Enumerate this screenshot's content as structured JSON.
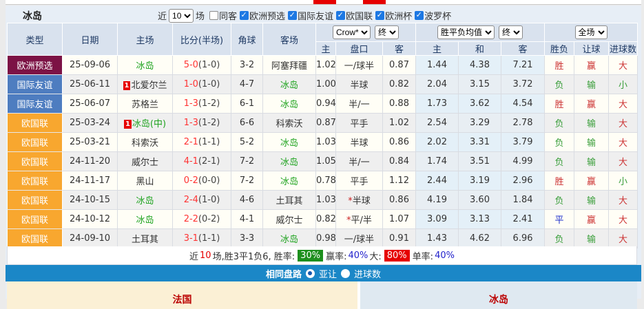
{
  "topbar": {
    "title": "冰岛",
    "near_label": "近",
    "games_value": "10",
    "games_label": "场",
    "checkboxes": [
      {
        "label": "同客",
        "checked": false
      },
      {
        "label": "欧洲预选",
        "checked": true
      },
      {
        "label": "国际友谊",
        "checked": true
      },
      {
        "label": "欧国联",
        "checked": true
      },
      {
        "label": "欧洲杯",
        "checked": true
      },
      {
        "label": "波罗杯",
        "checked": true
      }
    ]
  },
  "table": {
    "headers": {
      "type": "类型",
      "date": "日期",
      "home": "主场",
      "score": "比分(半场)",
      "corner": "角球",
      "away": "客场",
      "odds_source_select": "Crow*",
      "final_select_1": "终",
      "avg_select": "胜平负均值",
      "final_select_2": "终",
      "scope_select": "全场",
      "sub": [
        "主",
        "盘口",
        "客",
        "主",
        "和",
        "客",
        "胜负",
        "让球",
        "进球数"
      ]
    },
    "rows": [
      {
        "type": "欧洲预选",
        "type_color": "#7C1245",
        "date": "25-09-06",
        "badge": false,
        "home": "冰岛",
        "home_green": true,
        "score": "5-0",
        "half": "(1-0)",
        "corner": "3-2",
        "away": "阿塞拜疆",
        "away_green": false,
        "o1": "1.02",
        "star": false,
        "handicap": "一/球半",
        "o2": "0.87",
        "a1": "1.44",
        "a2": "4.38",
        "a3": "7.21",
        "r1": "胜",
        "r1c": "r",
        "r2": "赢",
        "r2c": "r",
        "r3": "大",
        "r3c": "r"
      },
      {
        "type": "国际友谊",
        "type_color": "#4E7DC0",
        "date": "25-06-11",
        "badge": true,
        "home": "北爱尔兰",
        "home_green": false,
        "score": "1-0",
        "half": "(1-0)",
        "corner": "4-7",
        "away": "冰岛",
        "away_green": true,
        "o1": "1.00",
        "star": false,
        "handicap": "半球",
        "o2": "0.82",
        "a1": "2.04",
        "a2": "3.15",
        "a3": "3.72",
        "r1": "负",
        "r1c": "g",
        "r2": "输",
        "r2c": "g",
        "r3": "小",
        "r3c": "g"
      },
      {
        "type": "国际友谊",
        "type_color": "#4E7DC0",
        "date": "25-06-07",
        "badge": false,
        "home": "苏格兰",
        "home_green": false,
        "score": "1-3",
        "half": "(1-2)",
        "corner": "6-1",
        "away": "冰岛",
        "away_green": true,
        "o1": "0.94",
        "star": false,
        "handicap": "半/一",
        "o2": "0.88",
        "a1": "1.73",
        "a2": "3.62",
        "a3": "4.54",
        "r1": "胜",
        "r1c": "r",
        "r2": "赢",
        "r2c": "r",
        "r3": "大",
        "r3c": "r"
      },
      {
        "type": "欧国联",
        "type_color": "#F8A72F",
        "date": "25-03-24",
        "badge": true,
        "home": "冰岛(中)",
        "home_green": true,
        "score": "1-3",
        "half": "(1-2)",
        "corner": "6-6",
        "away": "科索沃",
        "away_green": false,
        "o1": "0.87",
        "star": false,
        "handicap": "平手",
        "o2": "1.02",
        "a1": "2.54",
        "a2": "3.29",
        "a3": "2.78",
        "r1": "负",
        "r1c": "g",
        "r2": "输",
        "r2c": "g",
        "r3": "大",
        "r3c": "r"
      },
      {
        "type": "欧国联",
        "type_color": "#F8A72F",
        "date": "25-03-21",
        "badge": false,
        "home": "科索沃",
        "home_green": false,
        "score": "2-1",
        "half": "(1-1)",
        "corner": "5-2",
        "away": "冰岛",
        "away_green": true,
        "o1": "1.03",
        "star": false,
        "handicap": "半球",
        "o2": "0.86",
        "a1": "2.02",
        "a2": "3.31",
        "a3": "3.79",
        "r1": "负",
        "r1c": "g",
        "r2": "输",
        "r2c": "g",
        "r3": "大",
        "r3c": "r"
      },
      {
        "type": "欧国联",
        "type_color": "#F8A72F",
        "date": "24-11-20",
        "badge": false,
        "home": "威尔士",
        "home_green": false,
        "score": "4-1",
        "half": "(2-1)",
        "corner": "7-2",
        "away": "冰岛",
        "away_green": true,
        "o1": "1.05",
        "star": false,
        "handicap": "半/一",
        "o2": "0.84",
        "a1": "1.74",
        "a2": "3.51",
        "a3": "4.99",
        "r1": "负",
        "r1c": "g",
        "r2": "输",
        "r2c": "g",
        "r3": "大",
        "r3c": "r"
      },
      {
        "type": "欧国联",
        "type_color": "#F8A72F",
        "date": "24-11-17",
        "badge": false,
        "home": "黑山",
        "home_green": false,
        "score": "0-2",
        "half": "(0-0)",
        "corner": "7-2",
        "away": "冰岛",
        "away_green": true,
        "o1": "0.78",
        "star": false,
        "handicap": "平手",
        "o2": "1.12",
        "a1": "2.44",
        "a2": "3.19",
        "a3": "2.96",
        "r1": "胜",
        "r1c": "r",
        "r2": "赢",
        "r2c": "r",
        "r3": "小",
        "r3c": "g"
      },
      {
        "type": "欧国联",
        "type_color": "#F8A72F",
        "date": "24-10-15",
        "badge": false,
        "home": "冰岛",
        "home_green": true,
        "score": "2-4",
        "half": "(1-0)",
        "corner": "4-6",
        "away": "土耳其",
        "away_green": false,
        "o1": "1.03",
        "star": true,
        "handicap": "半球",
        "o2": "0.86",
        "a1": "4.19",
        "a2": "3.60",
        "a3": "1.84",
        "r1": "负",
        "r1c": "g",
        "r2": "输",
        "r2c": "g",
        "r3": "大",
        "r3c": "r"
      },
      {
        "type": "欧国联",
        "type_color": "#F8A72F",
        "date": "24-10-12",
        "badge": false,
        "home": "冰岛",
        "home_green": true,
        "score": "2-2",
        "half": "(0-2)",
        "corner": "4-1",
        "away": "威尔士",
        "away_green": false,
        "o1": "0.82",
        "star": true,
        "handicap": "平/半",
        "o2": "1.07",
        "a1": "3.09",
        "a2": "3.13",
        "a3": "2.41",
        "r1": "平",
        "r1c": "b",
        "r2": "赢",
        "r2c": "r",
        "r3": "大",
        "r3c": "r"
      },
      {
        "type": "欧国联",
        "type_color": "#F8A72F",
        "date": "24-09-10",
        "badge": false,
        "home": "土耳其",
        "home_green": false,
        "score": "3-1",
        "half": "(1-1)",
        "corner": "3-3",
        "away": "冰岛",
        "away_green": true,
        "o1": "0.98",
        "star": false,
        "handicap": "一/球半",
        "o2": "0.91",
        "a1": "1.43",
        "a2": "4.62",
        "a3": "6.96",
        "r1": "负",
        "r1c": "g",
        "r2": "输",
        "r2c": "g",
        "r3": "大",
        "r3c": "r"
      }
    ]
  },
  "summary": {
    "segments": [
      {
        "text": "近",
        "style": "plain"
      },
      {
        "text": "10",
        "style": "red"
      },
      {
        "text": "场,胜3平1负6, 胜率:",
        "style": "plain"
      },
      {
        "text": "30%",
        "style": "green-badge"
      },
      {
        "text": "赢率:",
        "style": "plain"
      },
      {
        "text": "40%",
        "style": "blue"
      },
      {
        "text": "大:",
        "style": "plain"
      },
      {
        "text": "80%",
        "style": "red-badge"
      },
      {
        "text": "单率:",
        "style": "plain"
      },
      {
        "text": "40%",
        "style": "blue"
      }
    ]
  },
  "filter_bar": {
    "label": "相同盘路",
    "options": [
      {
        "label": "亚让",
        "selected": true
      },
      {
        "label": "进球数",
        "selected": false
      }
    ]
  },
  "bottom_panels": {
    "left_title": "法国",
    "right_title": "冰岛"
  },
  "colors": {
    "bar_blue": "#1B87C7",
    "type_qualifier": "#7C1245",
    "type_friendly": "#4E7DC0",
    "type_nations_league": "#F8A72F",
    "win_red": "#CC3333",
    "lose_green": "#3A9E3A",
    "draw_blue": "#2233CC",
    "badge_green": "#1D8F1D",
    "badge_red": "#E60000"
  }
}
